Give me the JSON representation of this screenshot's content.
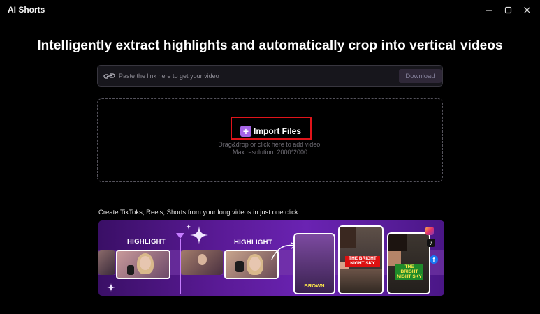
{
  "app": {
    "title": "AI Shorts"
  },
  "window_controls": {
    "minimize_icon": "minimize-icon",
    "maximize_icon": "maximize-icon",
    "close_icon": "close-icon"
  },
  "headline": "Intelligently extract highlights and automatically crop into vertical videos",
  "link_bar": {
    "placeholder": "Paste the link here to get your video",
    "value": "",
    "icon": "link-icon",
    "download_label": "Download"
  },
  "drop_zone": {
    "import_label": "Import Files",
    "import_icon": "plus-icon",
    "hint": "Drag&drop or click here to add video.",
    "max_resolution": "Max resolution: 2000*2000",
    "highlight_color": "#e0141a"
  },
  "promo": {
    "text": "Create TikToks, Reels, Shorts from your long videos in just one click.",
    "banner": {
      "labels": [
        "HIGHLIGHT",
        "HIGHLIGHT"
      ],
      "captions": [
        "THE BRIGHT NIGHT SKY",
        "THE BRIGHT NIGHT SKY",
        "BROWN"
      ],
      "social_icons": [
        "instagram-icon",
        "tiktok-icon",
        "facebook-icon"
      ]
    }
  },
  "colors": {
    "accent": "#a665e6",
    "background": "#000000"
  }
}
